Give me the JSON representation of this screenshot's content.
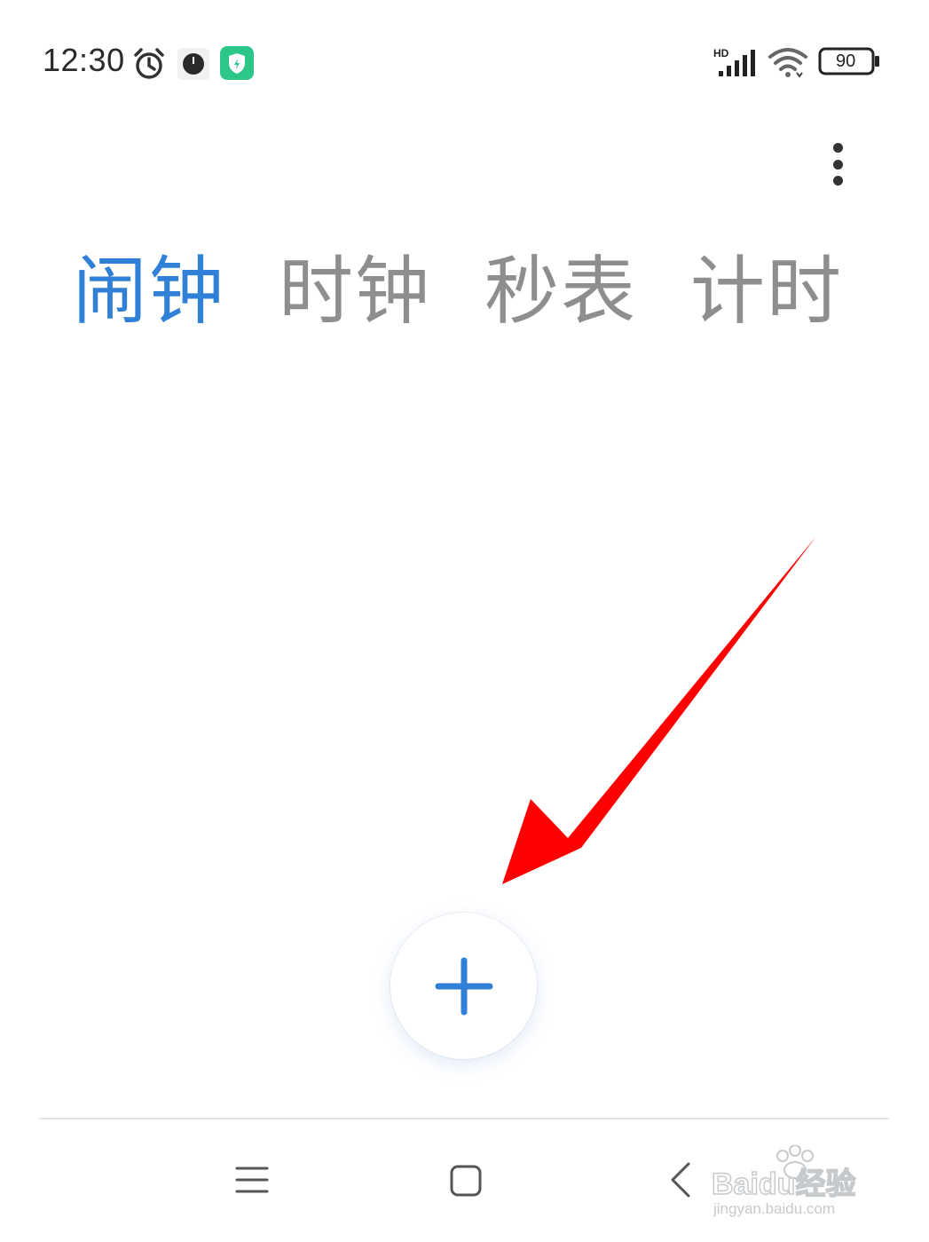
{
  "status_bar": {
    "time": "12:30",
    "left_icons": [
      "alarm-icon",
      "clock-dot-icon",
      "shield-app-icon"
    ],
    "right_icons": [
      "hd-signal-icon",
      "wifi-icon",
      "battery-icon"
    ],
    "battery_level": "90"
  },
  "toolbar": {
    "more_icon": "more-vertical-icon"
  },
  "tabs": [
    {
      "label": "闹钟",
      "active": true
    },
    {
      "label": "时钟",
      "active": false
    },
    {
      "label": "秒表",
      "active": false
    },
    {
      "label": "计时",
      "active": false
    }
  ],
  "add_button": {
    "icon": "plus-icon"
  },
  "nav_bar": {
    "icons": [
      "menu-icon",
      "home-icon",
      "back-icon"
    ]
  },
  "watermark": {
    "brand": "Baidu经验",
    "url": "jingyan.baidu.com"
  },
  "colors": {
    "accent": "#2f80d6",
    "tab_inactive": "#8e8e8e",
    "annotation_arrow": "#ff0000"
  }
}
